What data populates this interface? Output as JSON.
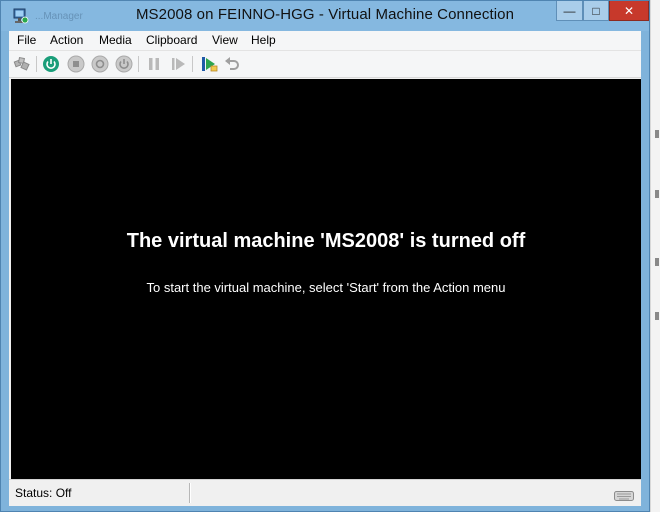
{
  "window": {
    "title": "MS2008 on FEINNO-HGG - Virtual Machine Connection",
    "ghost_title": "...Manager",
    "controls": {
      "minimize": "—",
      "maximize": "□",
      "close": "✕"
    }
  },
  "menu": {
    "items": [
      {
        "label": "File"
      },
      {
        "label": "Action"
      },
      {
        "label": "Media"
      },
      {
        "label": "Clipboard"
      },
      {
        "label": "View"
      },
      {
        "label": "Help"
      }
    ]
  },
  "toolbar": {
    "buttons": [
      {
        "icon": "ctrl-alt-del-icon",
        "enabled": false
      },
      {
        "icon": "start-icon",
        "enabled": true
      },
      {
        "icon": "turn-off-icon",
        "enabled": false
      },
      {
        "icon": "shut-down-icon",
        "enabled": false
      },
      {
        "icon": "save-icon",
        "enabled": false
      },
      {
        "icon": "pause-icon",
        "enabled": false
      },
      {
        "icon": "resume-icon",
        "enabled": false
      },
      {
        "icon": "snapshot-icon",
        "enabled": true
      },
      {
        "icon": "revert-icon",
        "enabled": false
      }
    ]
  },
  "screen": {
    "title": "The virtual machine 'MS2008' is turned off",
    "subtitle": "To start the virtual machine, select 'Start' from the Action menu"
  },
  "status": {
    "text": "Status: Off"
  },
  "colors": {
    "accent": "#1a9e7a",
    "titlebar": "#85b8e0",
    "close": "#c7392b",
    "screen": "#000000"
  }
}
